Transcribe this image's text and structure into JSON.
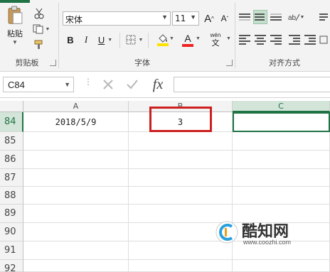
{
  "ribbon": {
    "clipboard": {
      "paste_label": "粘贴",
      "group_label": "剪贴板"
    },
    "font": {
      "name": "宋体",
      "size": "11",
      "bold": "B",
      "italic": "I",
      "underline": "U",
      "font_color_glyph": "A",
      "wen_top": "wén",
      "wen_bottom": "文",
      "grow_glyph": "A",
      "shrink_glyph": "A",
      "group_label": "字体"
    },
    "alignment": {
      "group_label": "对齐方式"
    }
  },
  "formula_bar": {
    "name_box": "C84",
    "fx": "fx",
    "formula": ""
  },
  "grid": {
    "columns": [
      "A",
      "B",
      "C"
    ],
    "rows": [
      "84",
      "85",
      "86",
      "87",
      "88",
      "89",
      "90",
      "91",
      "92"
    ],
    "cells": {
      "A84": "2018/5/9",
      "B84": "3"
    }
  },
  "watermark": {
    "brand": "酷知网",
    "url": "www.coozhi.com"
  },
  "colors": {
    "accent_green": "#217346",
    "highlight_red": "#cc1f1f",
    "fill_yellow": "#ffe100",
    "font_red": "#e22"
  }
}
